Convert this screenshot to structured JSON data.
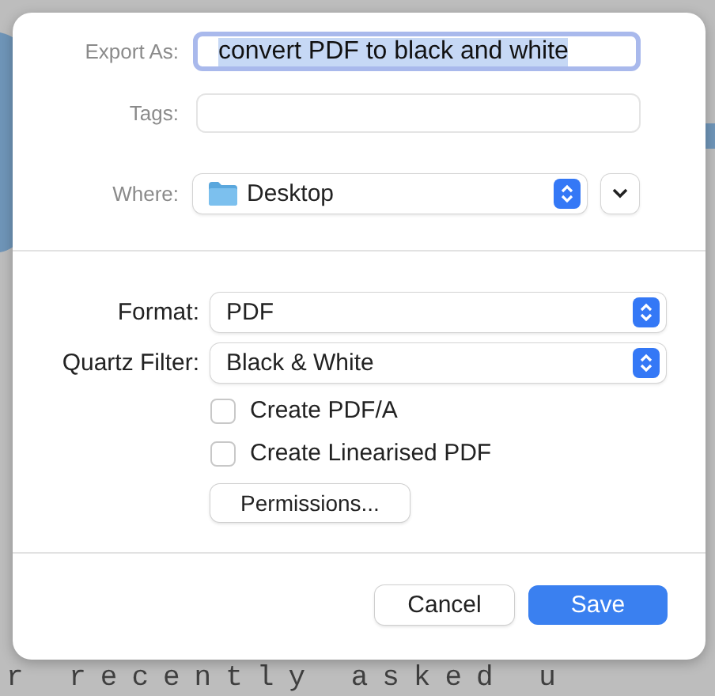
{
  "dialog": {
    "export_as": {
      "label": "Export As:",
      "value": "convert PDF to black and white",
      "text_selected": true,
      "focused": true
    },
    "tags": {
      "label": "Tags:"
    },
    "where": {
      "label": "Where:",
      "value": "Desktop",
      "expanded": false
    },
    "format": {
      "label": "Format:",
      "value": "PDF"
    },
    "quartz_filter": {
      "label": "Quartz Filter:",
      "value": "Black & White"
    },
    "options": [
      {
        "label": "Create PDF/A",
        "checked": false
      },
      {
        "label": "Create Linearised PDF",
        "checked": false
      }
    ],
    "permissions_button": "Permissions...",
    "buttons": [
      {
        "label": "Cancel",
        "kind": "secondary"
      },
      {
        "label": "Save",
        "kind": "primary"
      }
    ]
  },
  "background_text": "r recently asked u"
}
